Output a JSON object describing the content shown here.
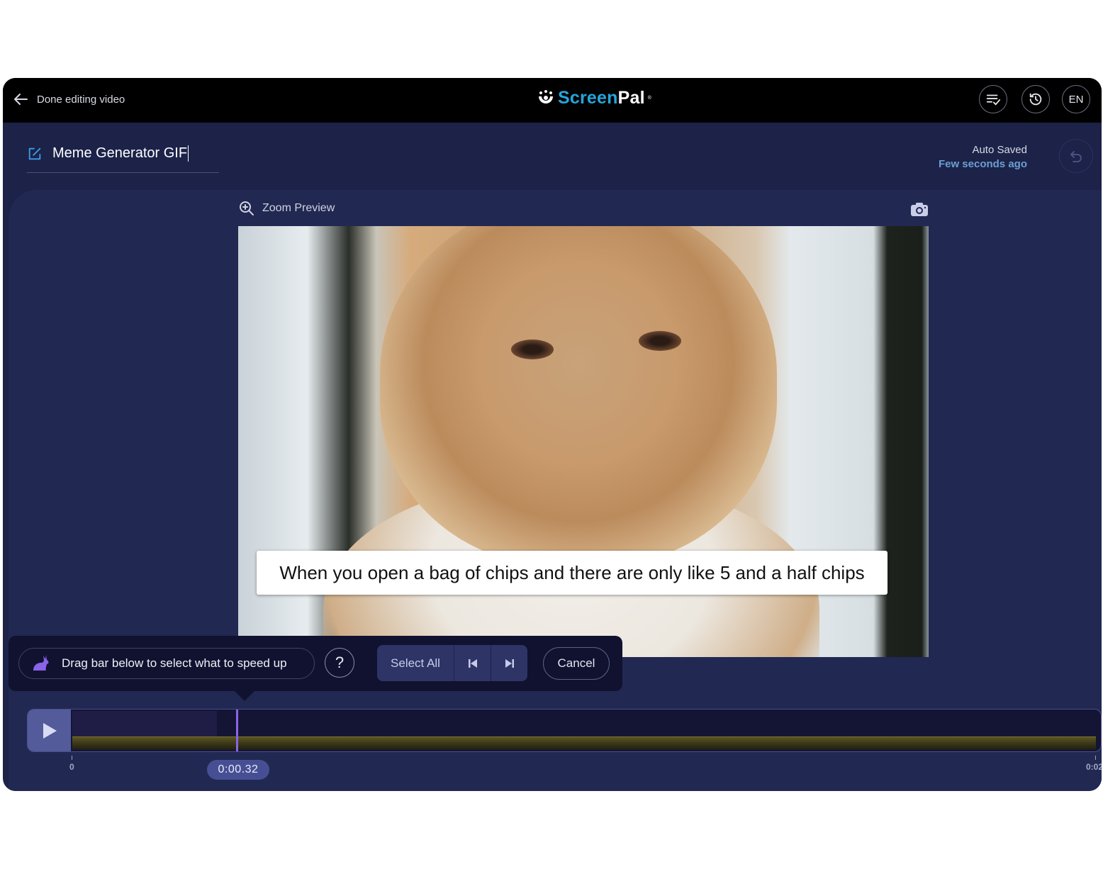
{
  "topbar": {
    "back_label": "Done editing video",
    "logo_brand_prefix": "Screen",
    "logo_brand_suffix": "Pal",
    "logo_reg_mark": "®",
    "buttons": [
      {
        "icon": "checklist-icon",
        "label": ""
      },
      {
        "icon": "history-icon",
        "label": ""
      },
      {
        "icon": "language",
        "label": "EN"
      }
    ]
  },
  "project": {
    "title": "Meme Generator GIF",
    "autosave_label": "Auto Saved",
    "autosave_time": "Few seconds ago"
  },
  "preview": {
    "zoom_label": "Zoom Preview",
    "caption": "When you open a bag of chips and there are only like 5 and a half chips"
  },
  "speed_tool": {
    "hint": "Drag bar below to select what to speed up",
    "help_label": "?",
    "select_all_label": "Select All",
    "cancel_label": "Cancel",
    "accent_color": "#8b64e6"
  },
  "timeline": {
    "start_label": "0",
    "end_label": "0:02",
    "current_time": "0:00.32",
    "playhead_fraction": 0.16
  }
}
